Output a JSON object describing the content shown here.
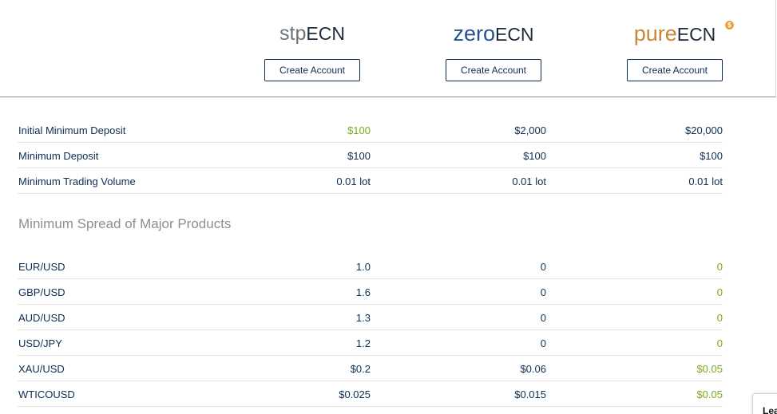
{
  "plans": [
    {
      "logo_prefix": "stp",
      "logo_suffix": "ECN",
      "button": "Create Account"
    },
    {
      "logo_prefix": "zero",
      "logo_suffix": "ECN",
      "button": "Create Account"
    },
    {
      "logo_prefix": "pure",
      "logo_suffix": "ECN",
      "button": "Create Account",
      "badge": "$"
    }
  ],
  "account_rows": [
    {
      "label": "Initial Minimum Deposit",
      "values": [
        "$100",
        "$2,000",
        "$20,000"
      ]
    },
    {
      "label": "Minimum Deposit",
      "values": [
        "$100",
        "$100",
        "$100"
      ]
    },
    {
      "label": "Minimum Trading Volume",
      "values": [
        "0.01 lot",
        "0.01 lot",
        "0.01 lot"
      ]
    }
  ],
  "spread_section_title": "Minimum Spread of Major Products",
  "spread_rows": [
    {
      "label": "EUR/USD",
      "values": [
        "1.0",
        "0",
        "0"
      ]
    },
    {
      "label": "GBP/USD",
      "values": [
        "1.6",
        "0",
        "0"
      ]
    },
    {
      "label": "AUD/USD",
      "values": [
        "1.3",
        "0",
        "0"
      ]
    },
    {
      "label": "USD/JPY",
      "values": [
        "1.2",
        "0",
        "0"
      ]
    },
    {
      "label": "XAU/USD",
      "values": [
        "$0.2",
        "$0.06",
        "$0.05"
      ]
    },
    {
      "label": "WTICOUSD",
      "values": [
        "$0.025",
        "$0.015",
        "$0.05"
      ]
    }
  ],
  "chat_widget_text": "Lea",
  "colors": {
    "accent_green": "#7aaa1f",
    "navy": "#0d2d52",
    "zero_blue": "#24528f",
    "pure_orange": "#c98836"
  }
}
